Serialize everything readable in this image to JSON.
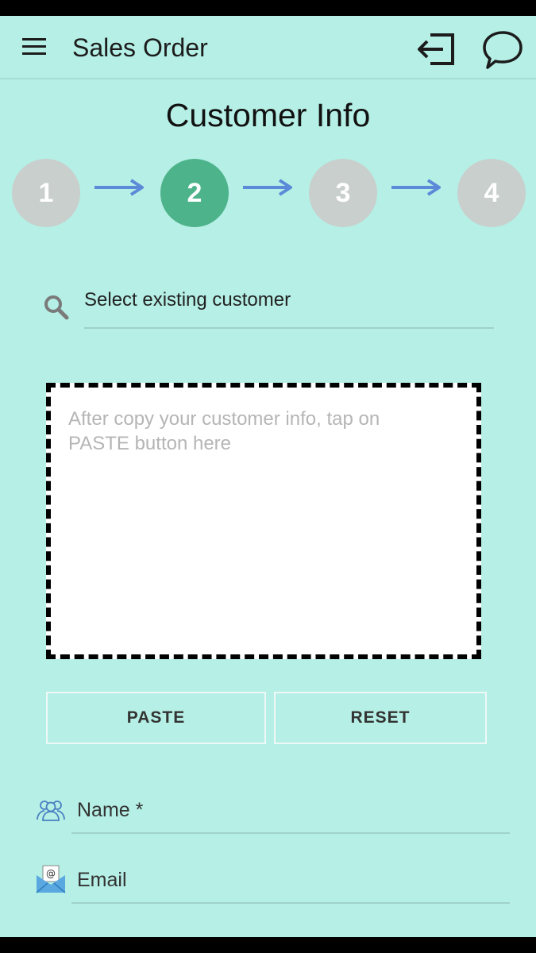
{
  "app_bar": {
    "title": "Sales Order",
    "menu_icon": "hamburger-menu-icon",
    "exit_icon": "logout-icon",
    "chat_icon": "chat-bubble-icon"
  },
  "page": {
    "heading": "Customer Info"
  },
  "steps": [
    {
      "label": "1",
      "active": false
    },
    {
      "label": "2",
      "active": true
    },
    {
      "label": "3",
      "active": false
    },
    {
      "label": "4",
      "active": false
    }
  ],
  "search": {
    "placeholder": "Select existing customer"
  },
  "paste_area": {
    "placeholder": "After copy your customer info, tap on PASTE button here"
  },
  "buttons": {
    "paste": "PASTE",
    "reset": "RESET"
  },
  "fields": {
    "name_label": "Name *",
    "email_label": "Email"
  },
  "colors": {
    "background": "#b5efe5",
    "active_step": "#4db38a",
    "inactive_step": "#c9cfcd",
    "arrow": "#5b8ad9"
  }
}
